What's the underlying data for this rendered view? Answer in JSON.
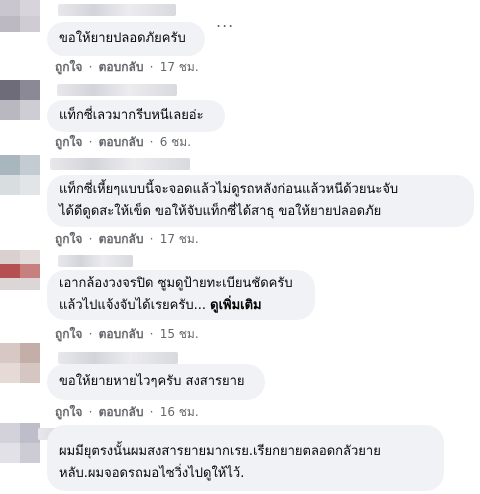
{
  "comments": [
    {
      "text_lines": [
        "ขอให้ยายปลอดภัยครับ"
      ],
      "like": "ถูกใจ",
      "reply": "ตอบกลับ",
      "time": "17 ชม."
    },
    {
      "text_lines": [
        "แท็กซี่เลวมากรีบหนีเลยอ่ะ"
      ],
      "like": "ถูกใจ",
      "reply": "ตอบกลับ",
      "time": "6 ชม."
    },
    {
      "text_lines": [
        "แท็กซี่เหี้ยๆแบบนี้จะจอดแล้วไม่ดูรถหลังก่อนแล้วหนีด้วยนะจับ",
        "ได้ดีดูดสะให้เข็ด ขอให้จับแท็กซี่ได้สาธุ ขอให้ยายปลอดภัย"
      ],
      "like": "ถูกใจ",
      "reply": "ตอบกลับ",
      "time": "17 ชม."
    },
    {
      "text_lines": [
        "เอากล้องวงจรปิด ซูมดูป้ายทะเบียนชัดครับ",
        "แล้วไปแจ้งจับได้เรยครับ..."
      ],
      "more": "ดูเพิ่มเติม",
      "like": "ถูกใจ",
      "reply": "ตอบกลับ",
      "time": "15 ชม."
    },
    {
      "text_lines": [
        "ขอให้ยายหายไวๆครับ สงสารยาย"
      ],
      "like": "ถูกใจ",
      "reply": "ตอบกลับ",
      "time": "16 ชม."
    },
    {
      "text_lines": [
        "ผมมียุตรงนั้นผมสงสารยายมากเรย.เรียกยายตลอดกลัวยาย",
        "หลับ.ผมจอดรถมอไซวิ่งไปดูให้ไว้."
      ]
    }
  ],
  "separator": "·",
  "options_label": "...",
  "colors": {
    "bubble": "#f0f2f5",
    "meta": "#65676b",
    "text": "#050505"
  }
}
